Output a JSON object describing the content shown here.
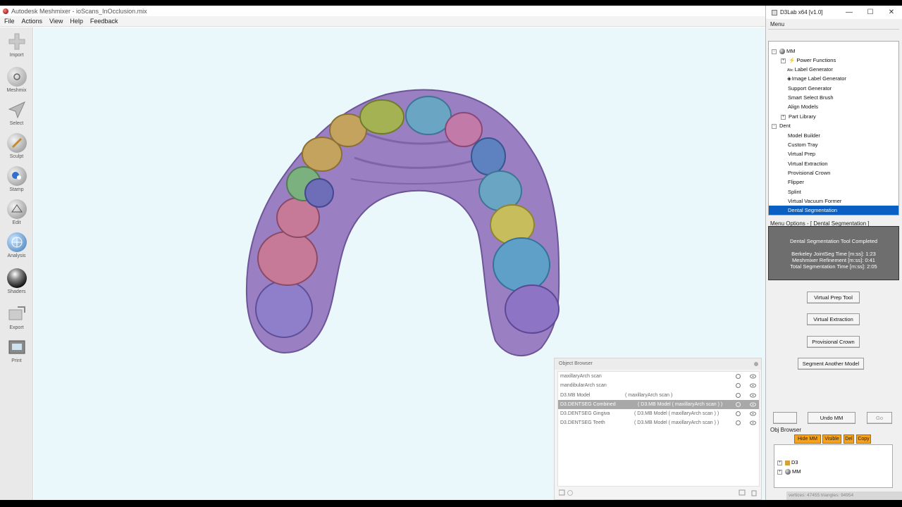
{
  "meshmixer": {
    "title": "Autodesk Meshmixer - ioScans_InOcclusion.mix",
    "menu": [
      "File",
      "Actions",
      "View",
      "Help",
      "Feedback"
    ],
    "tools": [
      {
        "label": "Import",
        "icon": "plus-icon"
      },
      {
        "label": "Meshmix",
        "icon": "meshmix-icon"
      },
      {
        "label": "Select",
        "icon": "select-arrow-icon"
      },
      {
        "label": "Sculpt",
        "icon": "brush-icon"
      },
      {
        "label": "Stamp",
        "icon": "stamp-icon"
      },
      {
        "label": "Edit",
        "icon": "edit-icon"
      },
      {
        "label": "Analysis",
        "icon": "analysis-icon"
      },
      {
        "label": "Shaders",
        "icon": "shaders-icon"
      },
      {
        "label": "Export",
        "icon": "export-icon"
      },
      {
        "label": "Print",
        "icon": "print-icon"
      }
    ],
    "object_browser": {
      "title": "Object Browser",
      "rows": [
        {
          "name": "maxillaryArch scan",
          "parent": "",
          "selected": false
        },
        {
          "name": "mandibularArch scan",
          "parent": "",
          "selected": false
        },
        {
          "name": "D3.MB Model",
          "parent": "( maxillaryArch scan )",
          "selected": false
        },
        {
          "name": "D3.DENTSEG Combined",
          "parent": "( D3.MB Model ( maxillaryArch scan ) )",
          "selected": true
        },
        {
          "name": "D3.DENTSEG Gingiva",
          "parent": "( D3.MB Model ( maxillaryArch scan ) )",
          "selected": false
        },
        {
          "name": "D3.DENTSEG Teeth",
          "parent": "( D3.MB Model ( maxillaryArch scan ) )",
          "selected": false
        }
      ]
    }
  },
  "d3lab": {
    "title": "D3Lab x64 [v1.0]",
    "menu_label": "Menu",
    "tree": [
      {
        "label": "MM",
        "indent": 0,
        "expander": "-",
        "icon": "mm-sphere-icon"
      },
      {
        "label": "Power Functions",
        "indent": 1,
        "expander": "+",
        "icon": "lightning-icon"
      },
      {
        "label": "Label Generator",
        "indent": 2,
        "expander": "",
        "icon": "abc-icon"
      },
      {
        "label": "Image Label Generator",
        "indent": 2,
        "expander": "",
        "icon": "diamond-icon"
      },
      {
        "label": "Support Generator",
        "indent": 2,
        "expander": "",
        "icon": ""
      },
      {
        "label": "Smart Select Brush",
        "indent": 2,
        "expander": "",
        "icon": ""
      },
      {
        "label": "Align Models",
        "indent": 2,
        "expander": "",
        "icon": ""
      },
      {
        "label": "Part Library",
        "indent": 1,
        "expander": "+",
        "icon": ""
      },
      {
        "label": "Dent",
        "indent": 0,
        "expander": "-",
        "icon": ""
      },
      {
        "label": "Model Builder",
        "indent": 2,
        "expander": "",
        "icon": ""
      },
      {
        "label": "Custom Tray",
        "indent": 2,
        "expander": "",
        "icon": ""
      },
      {
        "label": "Virtual Prep",
        "indent": 2,
        "expander": "",
        "icon": ""
      },
      {
        "label": "Virtual Extraction",
        "indent": 2,
        "expander": "",
        "icon": ""
      },
      {
        "label": "Provisional Crown",
        "indent": 2,
        "expander": "",
        "icon": ""
      },
      {
        "label": "Flipper",
        "indent": 2,
        "expander": "",
        "icon": ""
      },
      {
        "label": "Splint",
        "indent": 2,
        "expander": "",
        "icon": ""
      },
      {
        "label": "Virtual Vacuum Former",
        "indent": 2,
        "expander": "",
        "icon": ""
      },
      {
        "label": "Dental Segmentation",
        "indent": 2,
        "expander": "",
        "icon": "",
        "selected": true
      }
    ],
    "options_label": "Menu Options - [ Dental Segmentation ]",
    "status": {
      "headline": "Dental Segmentation Tool Completed",
      "line1": "Berkeley JointSeg Time [m:ss]: 1:23",
      "line2": "Meshmixer Refinement [m:ss]: 0:41",
      "line3": "Total Segmentation Time [m:ss]: 2:05"
    },
    "buttons": {
      "virtual_prep": "Virtual Prep Tool",
      "virtual_extraction": "Virtual Extraction",
      "provisional_crown": "Provisional Crown",
      "segment_another": "Segment Another Model",
      "undo": "Undo MM",
      "go": "Go"
    },
    "obj_browser_label": "Obj Browser",
    "obj_buttons": [
      "Hide MM",
      "Visible",
      "Del",
      "Copy"
    ],
    "obj_tree": [
      "D3",
      "MM"
    ],
    "status_strip": "vertices: 47455 triangles: 94954"
  }
}
